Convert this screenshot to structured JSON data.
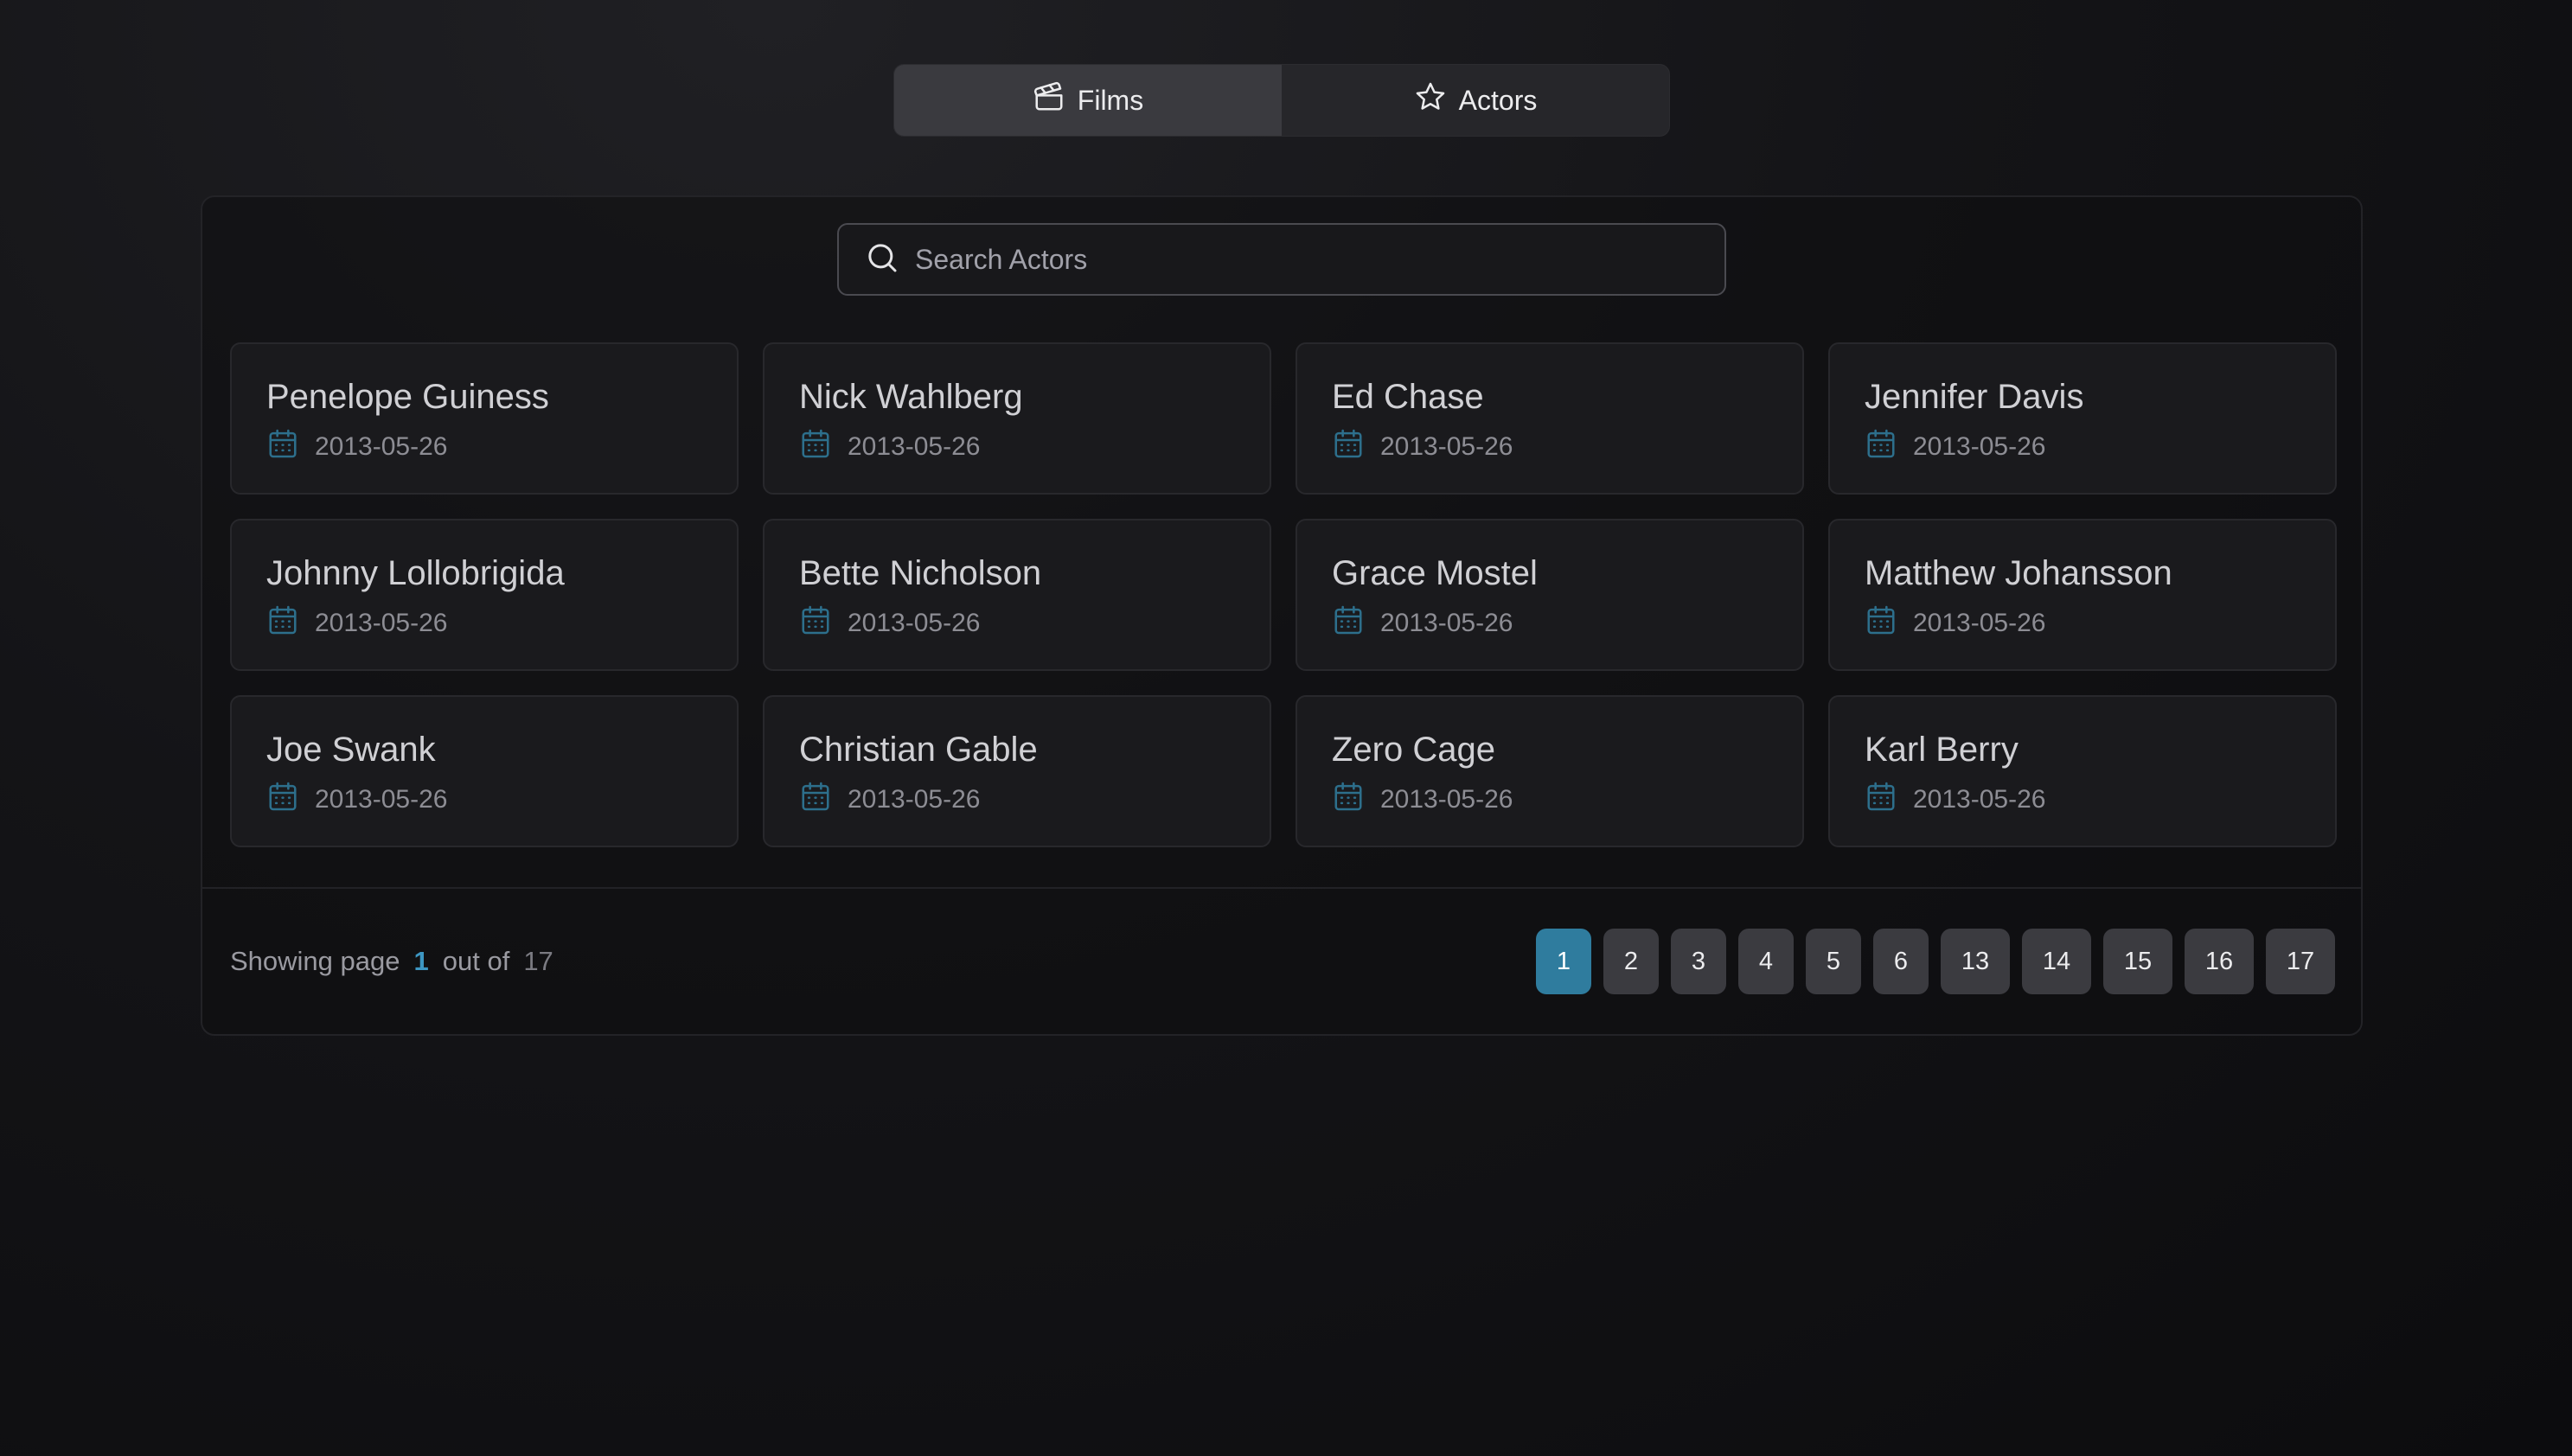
{
  "tabs": [
    {
      "label": "Films",
      "icon": "clapperboard-icon",
      "active": true
    },
    {
      "label": "Actors",
      "icon": "star-icon",
      "active": false
    }
  ],
  "search": {
    "placeholder": "Search Actors",
    "value": "",
    "icon": "search-icon"
  },
  "actors": [
    {
      "name": "Penelope Guiness",
      "date": "2013-05-26"
    },
    {
      "name": "Nick Wahlberg",
      "date": "2013-05-26"
    },
    {
      "name": "Ed Chase",
      "date": "2013-05-26"
    },
    {
      "name": "Jennifer Davis",
      "date": "2013-05-26"
    },
    {
      "name": "Johnny Lollobrigida",
      "date": "2013-05-26"
    },
    {
      "name": "Bette Nicholson",
      "date": "2013-05-26"
    },
    {
      "name": "Grace Mostel",
      "date": "2013-05-26"
    },
    {
      "name": "Matthew Johansson",
      "date": "2013-05-26"
    },
    {
      "name": "Joe Swank",
      "date": "2013-05-26"
    },
    {
      "name": "Christian Gable",
      "date": "2013-05-26"
    },
    {
      "name": "Zero Cage",
      "date": "2013-05-26"
    },
    {
      "name": "Karl Berry",
      "date": "2013-05-26"
    }
  ],
  "pagination": {
    "showing_label": "Showing page",
    "current": "1",
    "out_of_label": "out of",
    "total": "17",
    "pages": [
      "1",
      "2",
      "3",
      "4",
      "5",
      "6",
      "13",
      "14",
      "15",
      "16",
      "17"
    ],
    "active_page": "1"
  },
  "colors": {
    "accent": "#2f7c9e",
    "accent_text": "#3d96c2",
    "calendar_icon": "#2d6f8c"
  }
}
